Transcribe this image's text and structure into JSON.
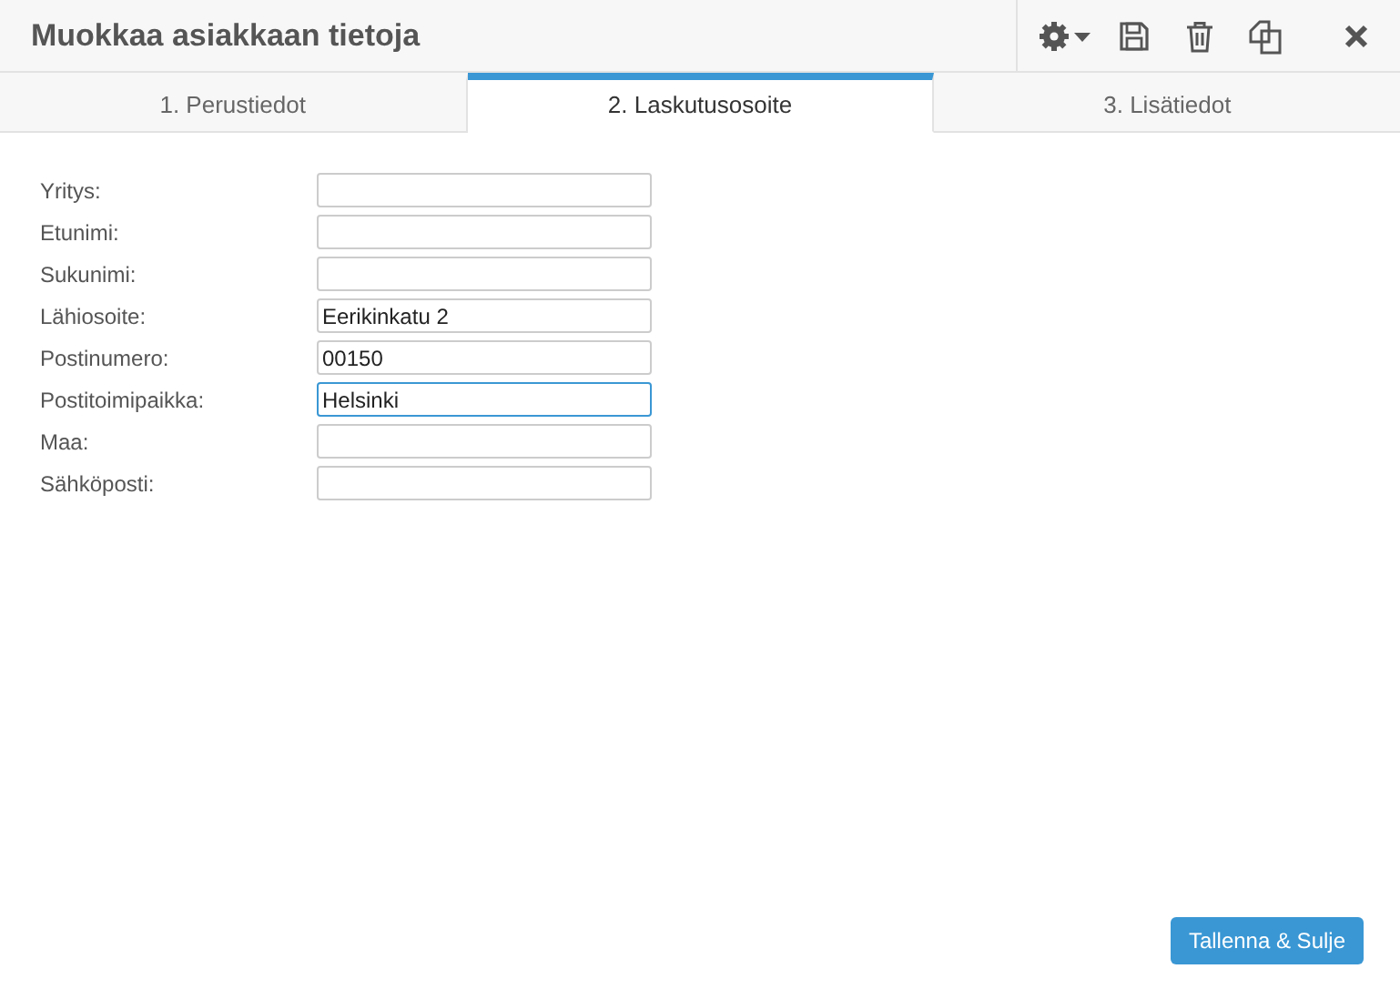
{
  "window": {
    "title": "Muokkaa asiakkaan tietoja"
  },
  "toolbar": [
    {
      "kind": "gear"
    },
    {
      "kind": "save"
    },
    {
      "kind": "trash"
    },
    {
      "kind": "copy"
    },
    {
      "kind": "close"
    }
  ],
  "tabs": [
    {
      "label": "1. Perustiedot",
      "selected": false
    },
    {
      "label": "2. Laskutusosoite",
      "selected": true
    },
    {
      "label": "3. Lisätiedot",
      "selected": false
    }
  ],
  "fields": [
    {
      "label": "Yritys:",
      "focused": false
    },
    {
      "label": "Etunimi:",
      "focused": false
    },
    {
      "label": "Sukunimi:",
      "focused": false
    },
    {
      "label": "Lähiosoite:",
      "value": "Eerikinkatu 2",
      "focused": false
    },
    {
      "label": "Postinumero:",
      "value": "00150",
      "focused": false
    },
    {
      "label": "Postitoimipaikka:",
      "value": "Helsinki",
      "focused": true
    },
    {
      "label": "Maa:",
      "focused": false
    },
    {
      "label": "Sähköposti:",
      "focused": false
    }
  ],
  "buttons": [
    {
      "label": "Tallenna & Sulje"
    }
  ]
}
